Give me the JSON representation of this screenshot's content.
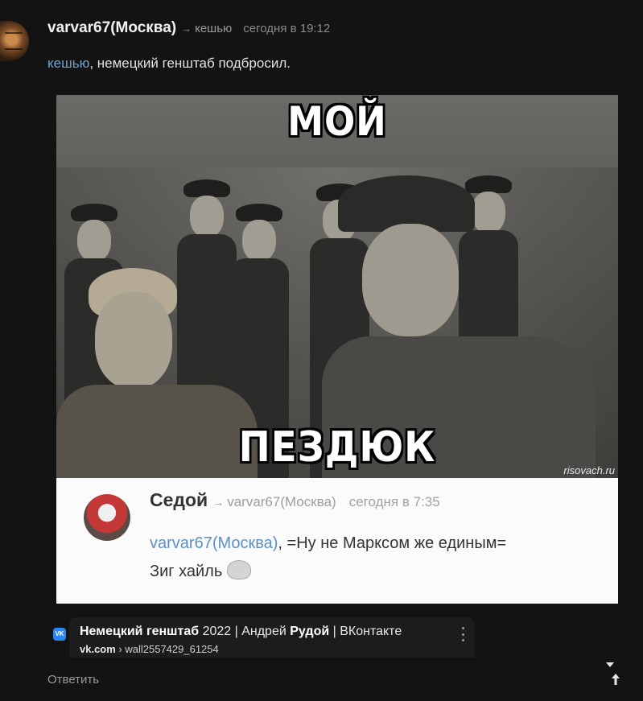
{
  "comment": {
    "author": "varvar67(Москва)",
    "arrow": "→",
    "reply_to": "кешью",
    "time": "сегодня в 19:12",
    "text_link": "кешью",
    "text_rest": ", немецкий генштаб подбросил."
  },
  "meme": {
    "top_text": "МОЙ",
    "bottom_text": "ПЕЗДЮК",
    "watermark": "risovach.ru"
  },
  "embedded_comment": {
    "author": "Седой",
    "arrow": "→",
    "reply_to": "varvar67(Москва)",
    "time": "сегодня в 7:35",
    "text_link": "varvar67(Москва)",
    "text_rest": ", =Ну не Марксом же единым=",
    "line2": "Зиг хайль"
  },
  "link_card": {
    "icon_text": "VK",
    "title_bold1": "Немецкий генштаб",
    "title_part2": " 2022 | Андрей ",
    "title_bold2": "Рудой",
    "title_part3": " | ВКонтакте",
    "url_domain": "vk.com",
    "url_path": " › wall2557429_61254"
  },
  "actions": {
    "reply_label": "Ответить"
  },
  "colors": {
    "background": "#131313",
    "link": "#6fa3d2",
    "vk_blue": "#2787f5"
  }
}
